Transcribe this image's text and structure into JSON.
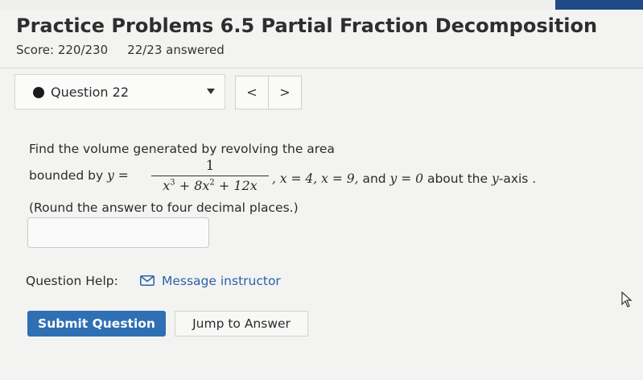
{
  "header": {
    "title": "Practice Problems 6.5 Partial Fraction Decomposition",
    "score": "Score: 220/230",
    "answered": "22/23 answered"
  },
  "question_nav": {
    "selected": "Question 22",
    "prev_label": "<",
    "next_label": ">"
  },
  "problem": {
    "line1": "Find the volume generated by revolving the area",
    "line2_prefix": "bounded by ",
    "fraction_numerator": "1",
    "fraction_denominator_parts": [
      "x",
      "3",
      " + 8x",
      "2",
      " + 12x"
    ],
    "bounds_text": ", x = 4, x = 9,",
    "and_text": " and ",
    "y_equals_zero": "y = 0",
    "about_text": " about the ",
    "axis_text": "y",
    "axis_suffix": "-axis .",
    "line3": "(Round the answer to four decimal places.)"
  },
  "answer": {
    "value": ""
  },
  "help": {
    "label": "Question Help:",
    "message_link": "Message instructor"
  },
  "actions": {
    "submit_label": "Submit Question",
    "jump_label": "Jump to Answer"
  }
}
